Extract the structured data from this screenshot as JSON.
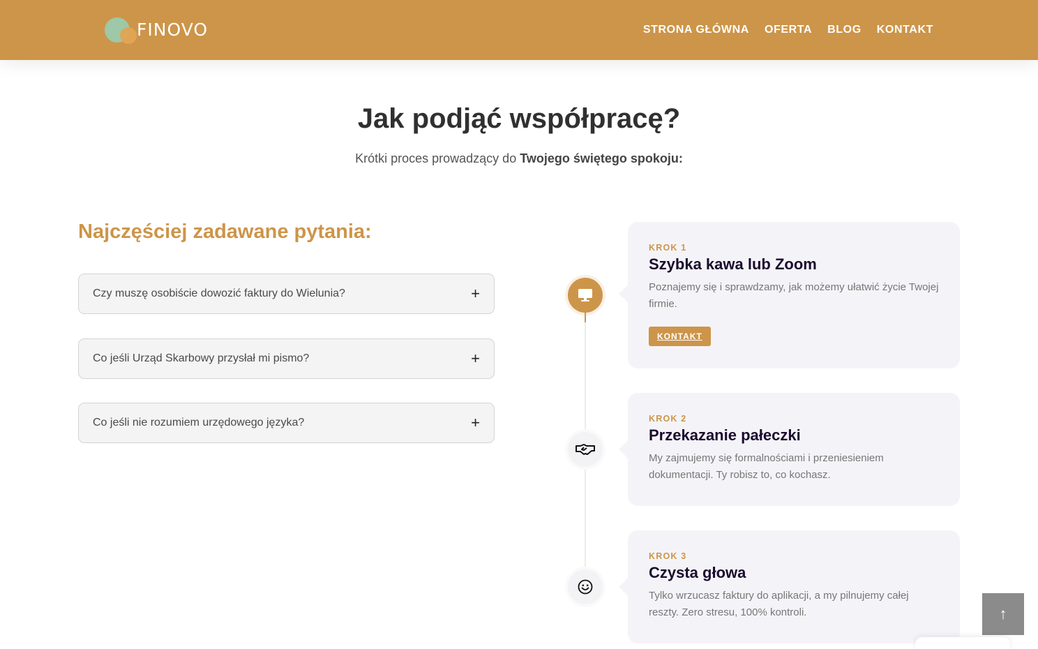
{
  "header": {
    "brand": "FINOVO",
    "nav": [
      "STRONA GŁÓWNA",
      "OFERTA",
      "BLOG",
      "KONTAKT"
    ]
  },
  "hero": {
    "title": "Jak podjąć współpracę?",
    "subtitle_prefix": "Krótki proces prowadzący do ",
    "subtitle_bold": "Twojego świętego spokoju:"
  },
  "faq": {
    "title": "Najczęściej zadawane pytania:",
    "items": [
      {
        "question": "Czy muszę osobiście dowozić faktury do Wielunia?",
        "icon": "plus-icon",
        "symbol": "+"
      },
      {
        "question": "Co jeśli Urząd Skarbowy przysłał mi pismo?",
        "icon": "plus-icon",
        "symbol": "+"
      },
      {
        "question": "Co jeśli nie rozumiem urzędowego języka?",
        "icon": "plus-icon",
        "symbol": "+"
      }
    ]
  },
  "steps": [
    {
      "label": "KROK 1",
      "title": "Szybka kawa lub Zoom",
      "text": "Poznajemy się i sprawdzamy, jak możemy ułatwić życie Twojej firmie.",
      "button": "KONTAKT",
      "icon": "monitor-icon"
    },
    {
      "label": "KROK 2",
      "title": "Przekazanie pałeczki",
      "text": "My zajmujemy się formalnościami i przeniesieniem dokumentacji. Ty robisz to, co kochasz.",
      "icon": "handshake-icon"
    },
    {
      "label": "KROK 3",
      "title": "Czysta głowa",
      "text": "Tylko wrzucasz faktury do aplikacji, a my pilnujemy całej reszty. Zero stresu, 100% kontroli.",
      "icon": "smile-icon"
    }
  ],
  "scroll_top": {
    "icon": "arrow-up-icon",
    "symbol": "↑"
  },
  "colors": {
    "accent": "#cd9549",
    "card_bg": "#f4f4f8",
    "heading": "#1b0b2e"
  }
}
